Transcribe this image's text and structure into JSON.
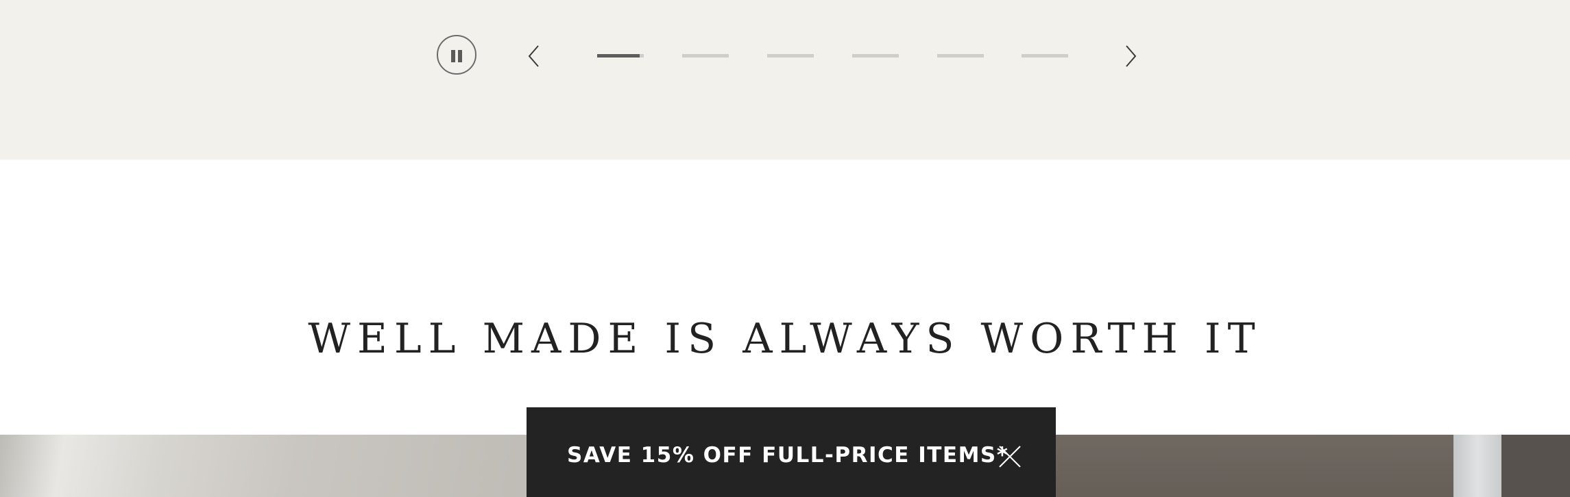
{
  "carousel": {
    "pause_icon": "pause-icon",
    "prev_icon": "chevron-left-icon",
    "next_icon": "chevron-right-icon",
    "slide_count": 6,
    "active_slide": 1,
    "active_progress": 0.9,
    "colors": {
      "band": "#f3f1ec",
      "dash_inactive": "#cfcecb",
      "dash_active": "#5d5d5d"
    }
  },
  "headline": "WELL MADE IS ALWAYS WORTH IT",
  "promo": {
    "text": "SAVE 15% OFF FULL-PRICE ITEMS*",
    "close_icon": "close-icon",
    "background": "#232323"
  }
}
